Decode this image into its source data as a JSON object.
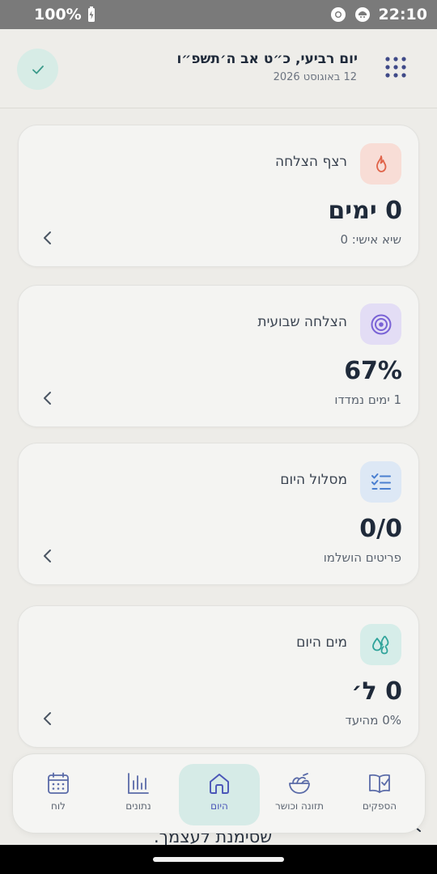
{
  "status_bar": {
    "battery": "100%",
    "time": "22:10"
  },
  "header": {
    "title": "יום רביעי, כ״ט אב ה׳תשפ״ו",
    "subtitle": "12 באוגוסט 2026"
  },
  "cards": [
    {
      "title": "רצף הצלחה",
      "value": "0 ימים",
      "subtitle": "שיא אישי: 0",
      "icon": "flame-icon"
    },
    {
      "title": "הצלחה שבועית",
      "value": "67%",
      "subtitle": "1 ימים נמדדו",
      "icon": "target-icon"
    },
    {
      "title": "מסלול היום",
      "value": "0/0",
      "subtitle": "פריטים הושלמו",
      "icon": "checklist-icon"
    },
    {
      "title": "מים היום",
      "value": "0 ל׳",
      "subtitle": "0% מהיעד",
      "icon": "water-drops-icon"
    }
  ],
  "peek_text": "שסימנת לעצמך.",
  "nav": [
    {
      "label": "לוח",
      "icon": "calendar-icon"
    },
    {
      "label": "נתונים",
      "icon": "bar-chart-icon"
    },
    {
      "label": "היום",
      "icon": "home-icon",
      "active": true
    },
    {
      "label": "תזונה וכושר",
      "icon": "salad-bowl-icon"
    },
    {
      "label": "הספקים",
      "icon": "book-check-icon"
    }
  ],
  "colors": {
    "accent": "#4a56b8",
    "accent_bg": "#d6ebe7",
    "flame": "#e0644a",
    "flame_bg": "#f8ddd6",
    "target": "#7a63d6",
    "target_bg": "#e3ddf5",
    "checklist": "#4a7fd0",
    "checklist_bg": "#dde8f5",
    "water": "#2fa39a",
    "water_bg": "#d6ede9"
  }
}
